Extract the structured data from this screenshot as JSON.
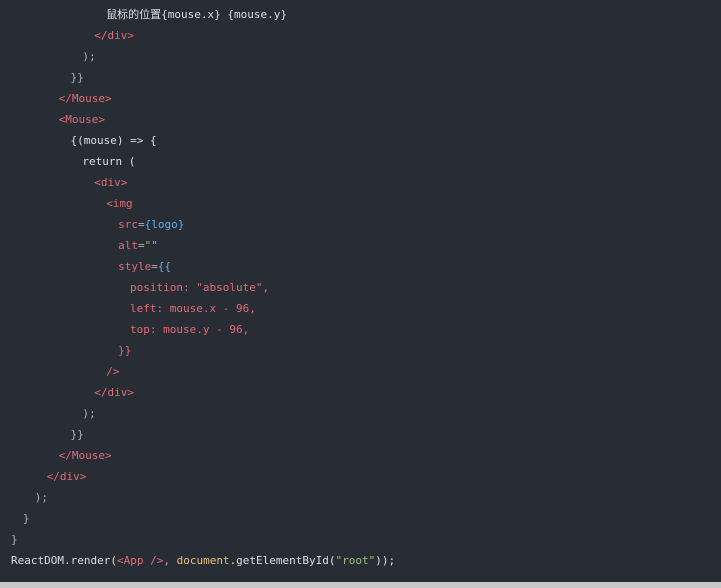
{
  "theme": {
    "background": "#282c34",
    "colors": {
      "text": "#abb2bf",
      "tag": "#e06c75",
      "attr": "#e06c75",
      "string": "#98c379",
      "identifier": "#61afef",
      "builtin": "#e5c07b",
      "plain": "#dcdfe4"
    }
  },
  "code_lines": [
    {
      "indent": 9,
      "tokens": [
        {
          "t": "鼠标的位置{mouse.x} {mouse.y}",
          "c": "plain"
        }
      ]
    },
    {
      "indent": 8,
      "tokens": [
        {
          "t": "</div>",
          "c": "tag"
        }
      ]
    },
    {
      "indent": 7,
      "tokens": [
        {
          "t": ");",
          "c": "text"
        }
      ]
    },
    {
      "indent": 6,
      "tokens": [
        {
          "t": "}}",
          "c": "text"
        }
      ]
    },
    {
      "indent": 5,
      "tokens": [
        {
          "t": "</Mouse>",
          "c": "tag"
        }
      ]
    },
    {
      "indent": 5,
      "tokens": [
        {
          "t": "<Mouse>",
          "c": "tag"
        }
      ]
    },
    {
      "indent": 6,
      "tokens": [
        {
          "t": "{(mouse) => {",
          "c": "plain"
        }
      ]
    },
    {
      "indent": 7,
      "tokens": [
        {
          "t": "return (",
          "c": "plain"
        }
      ]
    },
    {
      "indent": 8,
      "tokens": [
        {
          "t": "<div>",
          "c": "tag"
        }
      ]
    },
    {
      "indent": 9,
      "tokens": [
        {
          "t": "<img",
          "c": "tag"
        }
      ]
    },
    {
      "indent": 10,
      "tokens": [
        {
          "t": "src",
          "c": "attr"
        },
        {
          "t": "=",
          "c": "text"
        },
        {
          "t": "{logo}",
          "c": "identifier"
        }
      ]
    },
    {
      "indent": 10,
      "tokens": [
        {
          "t": "alt",
          "c": "attr"
        },
        {
          "t": "=",
          "c": "text"
        },
        {
          "t": "\"\"",
          "c": "string"
        }
      ]
    },
    {
      "indent": 10,
      "tokens": [
        {
          "t": "style",
          "c": "attr"
        },
        {
          "t": "=",
          "c": "text"
        },
        {
          "t": "{{",
          "c": "identifier"
        }
      ]
    },
    {
      "indent": 11,
      "tokens": [
        {
          "t": "position: \"absolute\",",
          "c": "attr"
        }
      ]
    },
    {
      "indent": 11,
      "tokens": [
        {
          "t": "left: mouse.x - 96,",
          "c": "attr"
        }
      ]
    },
    {
      "indent": 11,
      "tokens": [
        {
          "t": "top: mouse.y - 96,",
          "c": "attr"
        }
      ]
    },
    {
      "indent": 10,
      "tokens": [
        {
          "t": "}}",
          "c": "attr"
        }
      ]
    },
    {
      "indent": 9,
      "tokens": [
        {
          "t": "/>",
          "c": "tag"
        }
      ]
    },
    {
      "indent": 8,
      "tokens": [
        {
          "t": "</div>",
          "c": "tag"
        }
      ]
    },
    {
      "indent": 7,
      "tokens": [
        {
          "t": ");",
          "c": "text"
        }
      ]
    },
    {
      "indent": 6,
      "tokens": [
        {
          "t": "}}",
          "c": "text"
        }
      ]
    },
    {
      "indent": 5,
      "tokens": [
        {
          "t": "</Mouse>",
          "c": "tag"
        }
      ]
    },
    {
      "indent": 4,
      "tokens": [
        {
          "t": "</div>",
          "c": "tag"
        }
      ]
    },
    {
      "indent": 3,
      "tokens": [
        {
          "t": ");",
          "c": "text"
        }
      ]
    },
    {
      "indent": 2,
      "tokens": [
        {
          "t": "}",
          "c": "text"
        }
      ]
    },
    {
      "indent": 1,
      "tokens": [
        {
          "t": "}",
          "c": "text"
        }
      ]
    },
    {
      "indent": 1,
      "tokens": [
        {
          "t": "ReactDOM.render(",
          "c": "plain"
        },
        {
          "t": "<App />",
          "c": "tag"
        },
        {
          "t": ", ",
          "c": "text"
        },
        {
          "t": "document",
          "c": "builtin"
        },
        {
          "t": ".getElementById(",
          "c": "plain"
        },
        {
          "t": "\"root\"",
          "c": "string"
        },
        {
          "t": "));",
          "c": "plain"
        }
      ]
    }
  ]
}
